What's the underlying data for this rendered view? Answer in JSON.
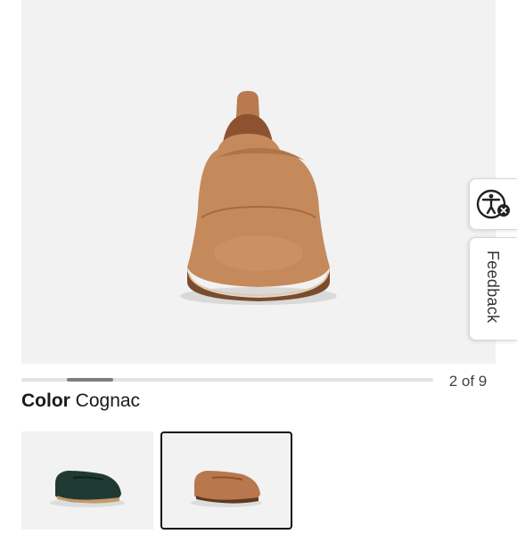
{
  "gallery": {
    "current": 2,
    "total": 9,
    "counter_text": "2 of 9"
  },
  "product": {
    "color_label": "Color",
    "color_value": "Cognac"
  },
  "swatches": [
    {
      "name": "Dark Green",
      "color": "#1f3a33",
      "selected": false
    },
    {
      "name": "Cognac",
      "color": "#b8774d",
      "selected": true
    }
  ],
  "side_tabs": {
    "feedback_label": "Feedback",
    "accessibility_icon": "accessibility-icon"
  },
  "colors": {
    "shoe_main": "#c58a5c",
    "shoe_shadow": "#a86a40",
    "sole": "#5e3a22"
  }
}
